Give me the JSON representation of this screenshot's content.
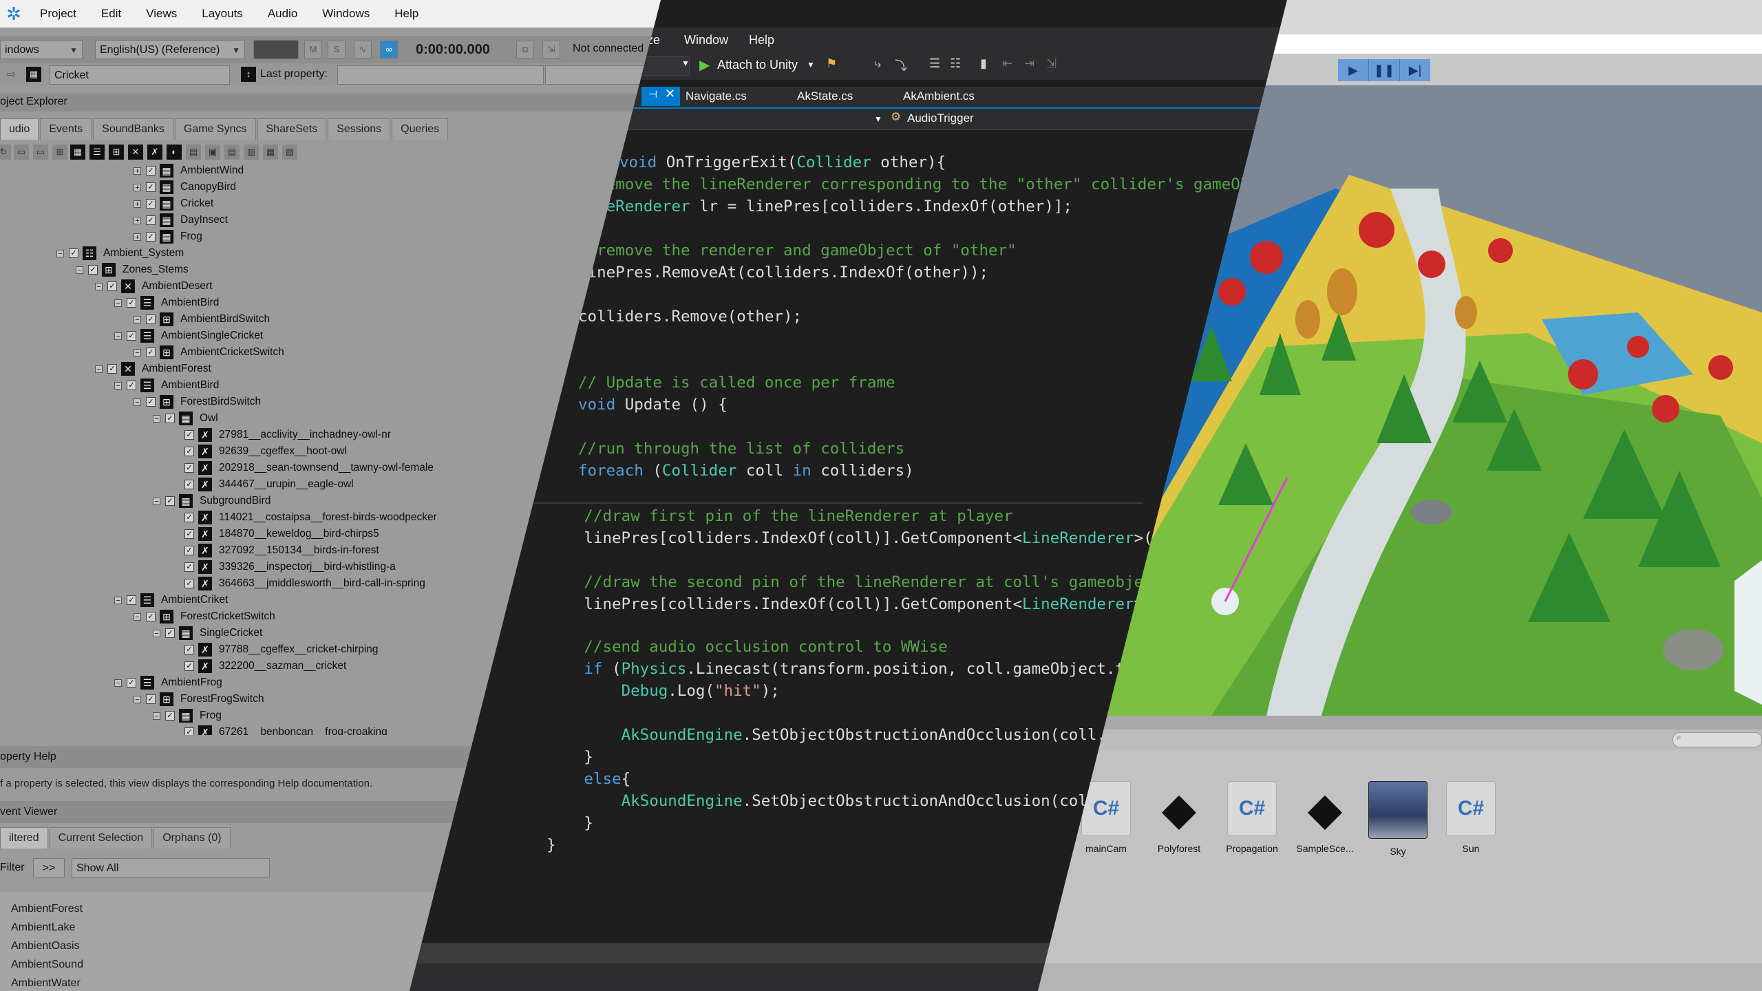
{
  "wwise": {
    "menu": [
      "Project",
      "Edit",
      "Views",
      "Layouts",
      "Audio",
      "Windows",
      "Help"
    ],
    "layout_combo": "indows",
    "language_combo": "English(US) (Reference)",
    "time": "0:00:00.000",
    "connection": "Not connected",
    "selected_object": "Cricket",
    "last_property_label": "Last property:",
    "project_explorer_title": "oject Explorer",
    "tabs": [
      "udio",
      "Events",
      "SoundBanks",
      "Game Syncs",
      "ShareSets",
      "Sessions",
      "Queries"
    ],
    "tree": [
      {
        "label": "AmbientWind",
        "indent": 5,
        "icon": "blend"
      },
      {
        "label": "CanopyBird",
        "indent": 5,
        "icon": "blend"
      },
      {
        "label": "Cricket",
        "indent": 5,
        "icon": "blend"
      },
      {
        "label": "DayInsect",
        "indent": 5,
        "icon": "blend"
      },
      {
        "label": "Frog",
        "indent": 5,
        "icon": "blend"
      },
      {
        "label": "Ambient_System",
        "indent": 1,
        "icon": "actor"
      },
      {
        "label": "Zones_Stems",
        "indent": 2,
        "icon": "switch"
      },
      {
        "label": "AmbientDesert",
        "indent": 3,
        "icon": "random"
      },
      {
        "label": "AmbientBird",
        "indent": 4,
        "icon": "sequence"
      },
      {
        "label": "AmbientBirdSwitch",
        "indent": 5,
        "icon": "switch"
      },
      {
        "label": "AmbientSingleCricket",
        "indent": 4,
        "icon": "sequence"
      },
      {
        "label": "AmbientCricketSwitch",
        "indent": 5,
        "icon": "switch"
      },
      {
        "label": "AmbientForest",
        "indent": 3,
        "icon": "random"
      },
      {
        "label": "AmbientBird",
        "indent": 4,
        "icon": "sequence"
      },
      {
        "label": "ForestBirdSwitch",
        "indent": 5,
        "icon": "switch"
      },
      {
        "label": "Owl",
        "indent": 6,
        "icon": "blend"
      },
      {
        "label": "27981__acclivity__inchadney-owl-nr",
        "indent": 7,
        "icon": "sound"
      },
      {
        "label": "92639__cgeffex__hoot-owl",
        "indent": 7,
        "icon": "sound"
      },
      {
        "label": "202918__sean-townsend__tawny-owl-female",
        "indent": 7,
        "icon": "sound"
      },
      {
        "label": "344467__urupin__eagle-owl",
        "indent": 7,
        "icon": "sound"
      },
      {
        "label": "SubgroundBird",
        "indent": 6,
        "icon": "blend"
      },
      {
        "label": "114021__costaipsa__forest-birds-woodpecker",
        "indent": 7,
        "icon": "sound"
      },
      {
        "label": "184870__keweldog__bird-chirps5",
        "indent": 7,
        "icon": "sound"
      },
      {
        "label": "327092__150134__birds-in-forest",
        "indent": 7,
        "icon": "sound"
      },
      {
        "label": "339326__inspectorj__bird-whistling-a",
        "indent": 7,
        "icon": "sound"
      },
      {
        "label": "364663__jmiddlesworth__bird-call-in-spring",
        "indent": 7,
        "icon": "sound"
      },
      {
        "label": "AmbientCriket",
        "indent": 4,
        "icon": "sequence"
      },
      {
        "label": "ForestCricketSwitch",
        "indent": 5,
        "icon": "switch"
      },
      {
        "label": "SingleCricket",
        "indent": 6,
        "icon": "blend"
      },
      {
        "label": "97788__cgeffex__cricket-chirping",
        "indent": 7,
        "icon": "sound"
      },
      {
        "label": "322200__sazman__cricket",
        "indent": 7,
        "icon": "sound"
      },
      {
        "label": "AmbientFrog",
        "indent": 4,
        "icon": "sequence"
      },
      {
        "label": "ForestFrogSwitch",
        "indent": 5,
        "icon": "switch"
      },
      {
        "label": "Frog",
        "indent": 6,
        "icon": "blend"
      },
      {
        "label": "67261__benboncan__frog-croaking",
        "indent": 7,
        "icon": "sound"
      }
    ],
    "property_help_title": "operty Help",
    "property_help_text": "f a property is selected, this view displays the corresponding Help documentation.",
    "event_viewer_title": "vent Viewer",
    "event_tabs": [
      "iltered",
      "Current Selection",
      "Orphans (0)"
    ],
    "filter_label": "Filter",
    "filter_button": ">>",
    "filter_value": "Show All",
    "events": [
      "AmbientForest",
      "AmbientLake",
      "AmbientOasis",
      "AmbientSound",
      "AmbientWater"
    ]
  },
  "vs": {
    "menu": [
      "ze",
      "Window",
      "Help"
    ],
    "attach_label": "Attach to Unity",
    "tabs": [
      "Navigate.cs",
      "AkState.cs",
      "AkAmbient.cs"
    ],
    "nav_member": "AudioTrigger"
  },
  "unity": {
    "assets": [
      {
        "label": "mainCam",
        "type": "script"
      },
      {
        "label": "Polyforest",
        "type": "unity"
      },
      {
        "label": "Propagation",
        "type": "script"
      },
      {
        "label": "SampleSce...",
        "type": "unity"
      },
      {
        "label": "Sky",
        "type": "material"
      },
      {
        "label": "Sun",
        "type": "script"
      }
    ]
  },
  "colors": {
    "vs_keyword": "#569cd6",
    "vs_type": "#4ec9b0",
    "vs_comment": "#57a64a",
    "vs_string": "#d69d85",
    "unity_play": "#6a9bd9"
  }
}
